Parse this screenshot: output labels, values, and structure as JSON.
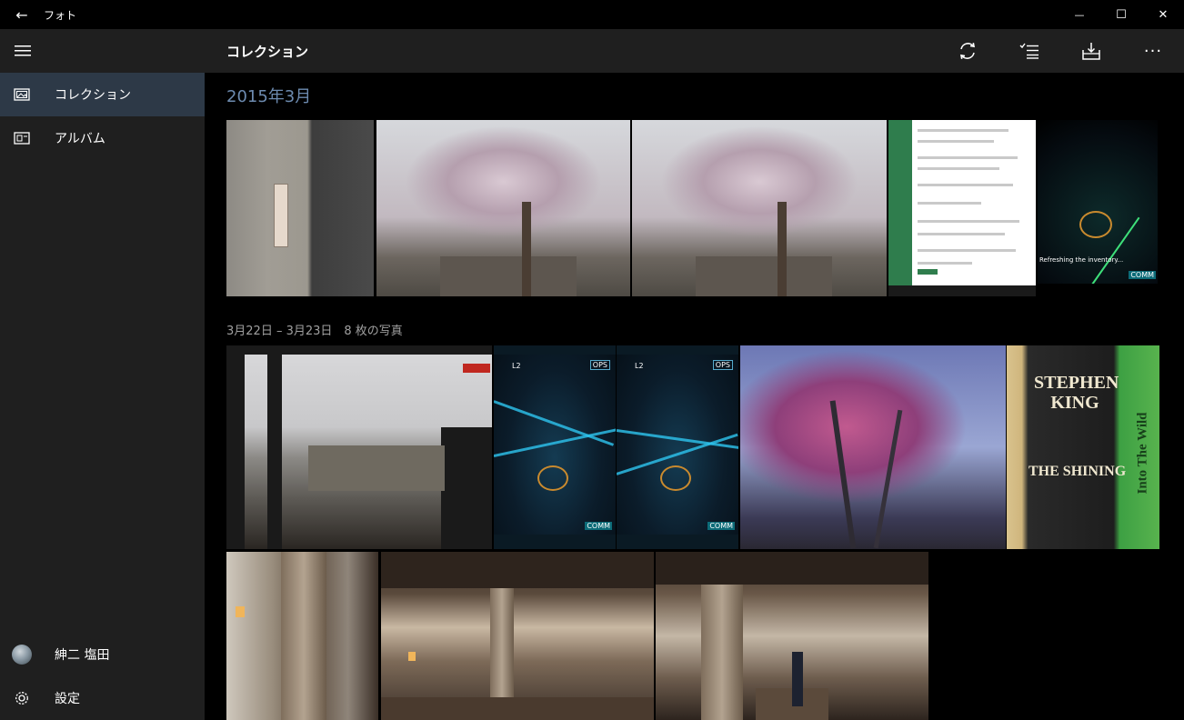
{
  "window": {
    "title": "フォト",
    "back_glyph": "←",
    "minimize_glyph": "—",
    "maximize_glyph": "☐",
    "close_glyph": "✕"
  },
  "sidebar": {
    "menu_glyph": "☰",
    "items": [
      {
        "label": "コレクション",
        "active": true
      },
      {
        "label": "アルバム",
        "active": false
      }
    ],
    "user": {
      "name": "紳二 塩田"
    },
    "settings_label": "設定"
  },
  "header": {
    "title": "コレクション",
    "more_glyph": "···"
  },
  "main": {
    "month_heading": "2015年3月",
    "group_heading": "3月22日 – 3月23日　8 枚の写真",
    "photo_texts": {
      "game_status": "Refreshing the inventory...",
      "game_comm": "COMM",
      "ingress_level": "L2",
      "ingress_ops": "OPS",
      "ingress_comm": "COMM",
      "book_title": "STEPHEN KING",
      "book_subtitle": "THE SHINING",
      "book_spine": "Into The Wild"
    }
  },
  "colors": {
    "accent_heading": "#6d8bb0",
    "sidebar_bg": "#1f1f1f",
    "nav_selected_bg": "#2d3947"
  }
}
